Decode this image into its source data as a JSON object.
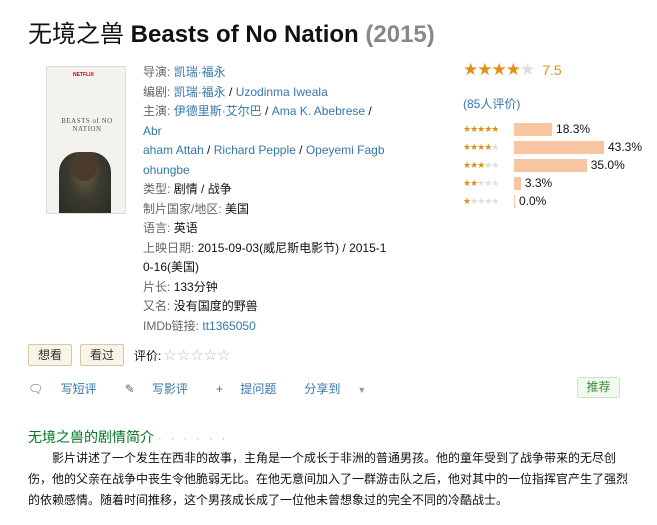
{
  "title": {
    "cn": "无境之兽",
    "en": "Beasts of No Nation",
    "year": "(2015)"
  },
  "poster": {
    "brand": "NETFLIX",
    "film": "BEASTS of NO NATION"
  },
  "info": {
    "director_label": "导演:",
    "director": "凯瑞·福永",
    "writer_label": "编剧:",
    "writer1": "凯瑞·福永",
    "writer2": "Uzodinma Iweala",
    "cast_label": "主演:",
    "cast1": "伊德里斯·艾尔巴",
    "cast2": "Ama K. Abebrese",
    "cast3a": "Abr",
    "cast3b": "aham Attah",
    "cast4": "Richard Pepple",
    "cast5a": "Opeyemi Fagb",
    "cast5b": "ohungbe",
    "genre_label": "类型:",
    "genre": "剧情 / 战争",
    "country_label": "制片国家/地区:",
    "country": "美国",
    "language_label": "语言:",
    "language": "英语",
    "release_label": "上映日期:",
    "release_a": "2015-09-03(威尼斯电影节) / 2015-1",
    "release_b": "0-16(美国)",
    "runtime_label": "片长:",
    "runtime": "133分钟",
    "aka_label": "又名:",
    "aka": "没有国度的野兽",
    "imdb_label": "IMDb链接:",
    "imdb": "tt1365050"
  },
  "rating": {
    "score": "7.5",
    "stars": 4,
    "votes": "(85人评价)",
    "breakdown": [
      {
        "stars": 5,
        "percent": "18.3%",
        "value": 18.3
      },
      {
        "stars": 4,
        "percent": "43.3%",
        "value": 43.3
      },
      {
        "stars": 3,
        "percent": "35.0%",
        "value": 35.0
      },
      {
        "stars": 2,
        "percent": "3.3%",
        "value": 3.3
      },
      {
        "stars": 1,
        "percent": "0.0%",
        "value": 0.0
      }
    ]
  },
  "actions": {
    "want": "想看",
    "seen": "看过",
    "rate_label": "评价:"
  },
  "tools": {
    "short_review": "写短评",
    "review": "写影评",
    "question": "提问题",
    "share": "分享到",
    "recommend": "推荐"
  },
  "intro": {
    "heading": "无境之兽的剧情简介",
    "heading_dots": "· · · · · ·",
    "text": "　　影片讲述了一个发生在西非的故事，主角是一个成长于非洲的普通男孩。他的童年受到了战争带来的无尽创伤，他的父亲在战争中丧生令他脆弱无比。在他无意间加入了一群游击队之后，他对其中的一位指挥官产生了强烈的依赖感情。随着时间推移，这个男孩成长成了一位他未曾想象过的完全不同的冷酷战士。"
  },
  "icons": {
    "comment": "comment-icon",
    "pen": "pen-icon",
    "plus": "plus-icon",
    "dropdown": "dropdown-arrow-icon"
  },
  "colors": {
    "link": "#3377aa",
    "star": "#e09015",
    "bar": "#f7c5a0",
    "green": "#007722"
  }
}
